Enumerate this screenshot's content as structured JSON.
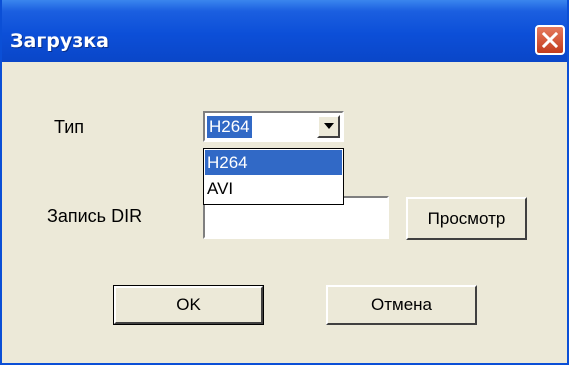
{
  "window": {
    "title": "Загрузка"
  },
  "form": {
    "type_label": "Тип",
    "type_selected": "H264",
    "type_options": [
      "H264",
      "AVI"
    ],
    "dir_label": "Запись DIR",
    "dir_value": "",
    "browse_label": "Просмотр"
  },
  "buttons": {
    "ok": "OK",
    "cancel": "Отмена"
  },
  "colors": {
    "titlebar": "#0c4fd8",
    "selection": "#3169c6",
    "close": "#d55a3c",
    "background": "#ece9d8"
  }
}
